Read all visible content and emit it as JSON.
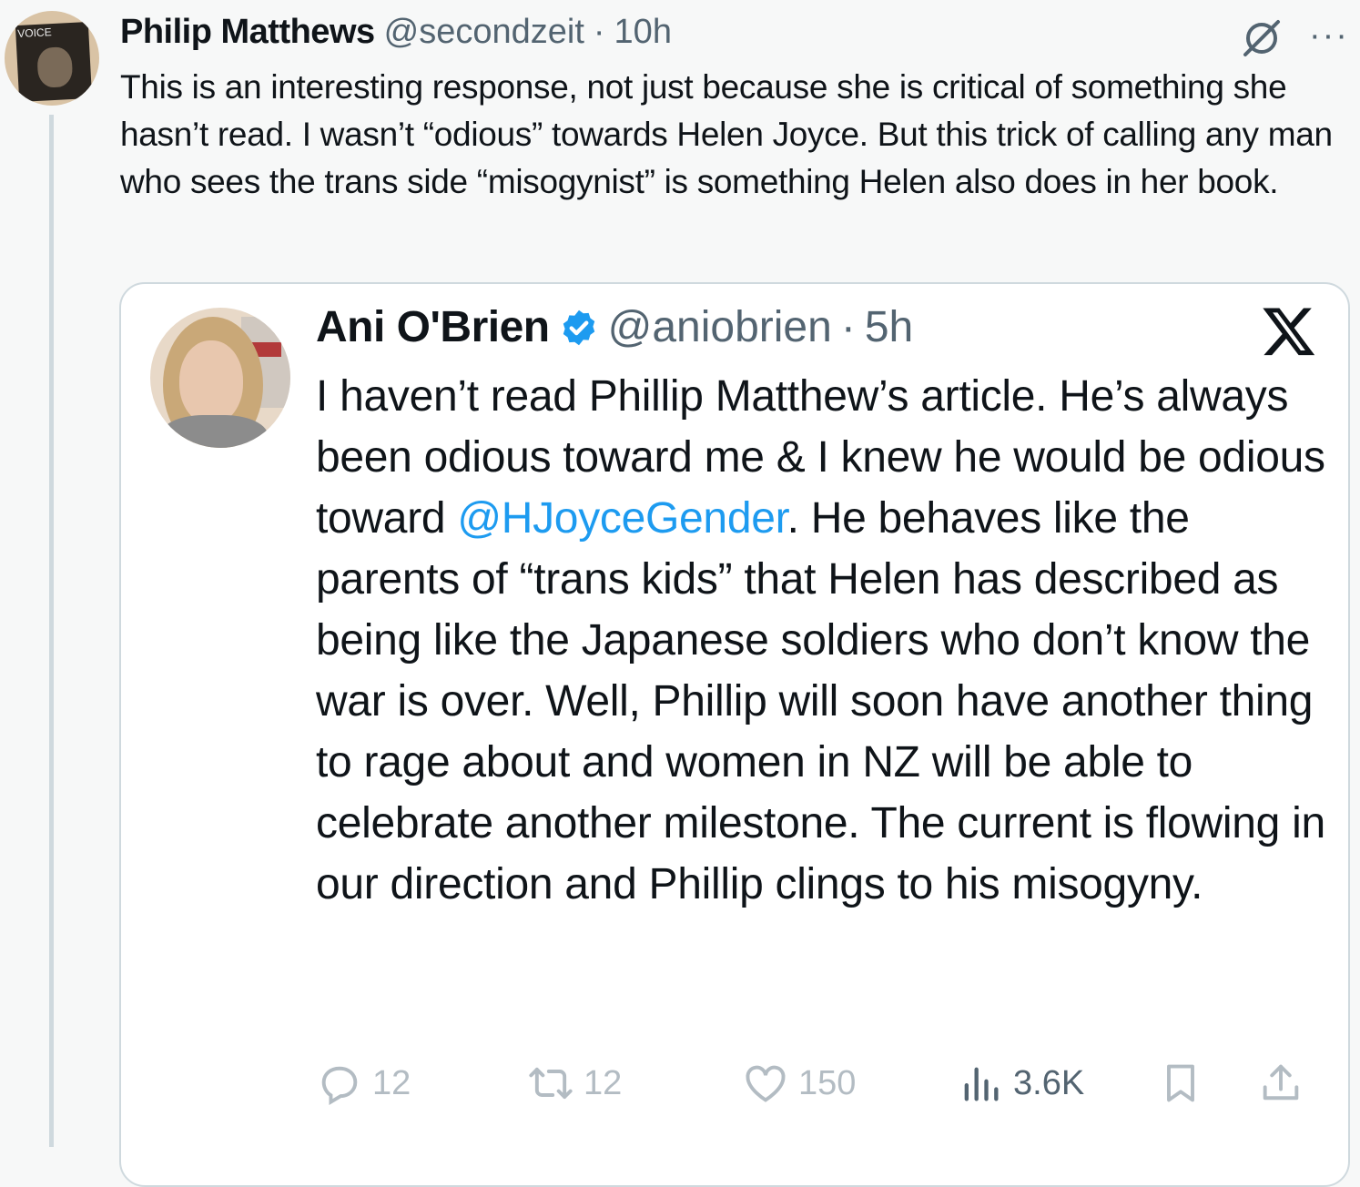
{
  "tweet": {
    "author_name": "Philip Matthews",
    "handle": "@secondzeit",
    "separator": "·",
    "time": "10h",
    "more_label": "···",
    "text": "This is an interesting response, not just because she is critical of something she hasn’t read. I wasn’t “odious” towards Helen Joyce. But this trick of calling any man who sees the trans side “misogynist” is something Helen also does in her book.",
    "avatar_text": "VOICE"
  },
  "quote": {
    "author_name": "Ani O'Brien",
    "handle": "@aniobrien",
    "separator": "·",
    "time": "5h",
    "text_before": "I haven’t read Phillip Matthew’s article. He’s always been odious toward me & I knew he would be odious toward ",
    "mention": "@HJoyceGender",
    "text_after": ". He behaves like the parents of “trans kids” that Helen has described as being like the Japanese soldiers who don’t know the war is over. Well, Phillip will soon have another thing to rage about and women in NZ will be able to celebrate another milestone. The current is flowing in our direction and Phillip clings to his misogyny.",
    "actions": {
      "replies": "12",
      "reposts": "12",
      "likes": "150",
      "views": "3.6K"
    }
  },
  "colors": {
    "accent": "#1d9bf0",
    "muted": "#536471",
    "faded": "#b3bcc3",
    "border": "#cfd9de"
  }
}
